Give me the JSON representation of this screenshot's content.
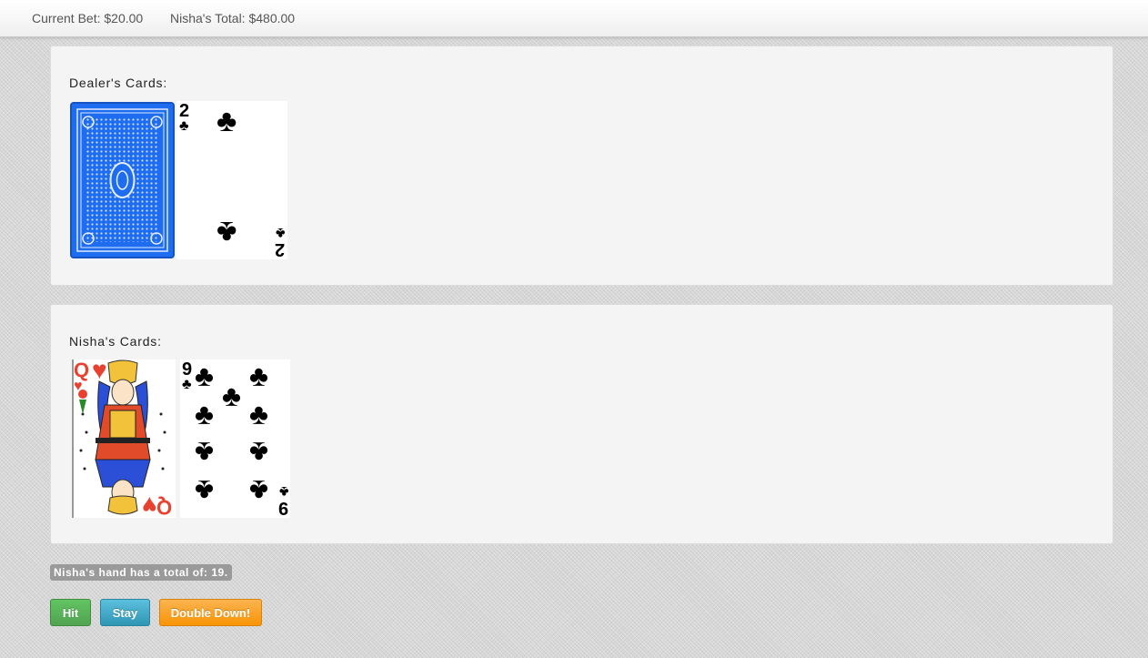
{
  "header": {
    "current_bet": "Current Bet: $20.00",
    "player_total": "Nisha's Total: $480.00"
  },
  "dealer": {
    "label": "Dealer's Cards:",
    "cards": [
      {
        "face": "back"
      },
      {
        "rank": "2",
        "suit": "clubs",
        "suit_symbol": "♣"
      }
    ]
  },
  "player": {
    "label": "Nisha's Cards:",
    "cards": [
      {
        "rank": "Q",
        "suit": "hearts",
        "suit_symbol": "♥"
      },
      {
        "rank": "9",
        "suit": "clubs",
        "suit_symbol": "♣"
      }
    ]
  },
  "hand_total_text": "Nisha's hand has a total of: 19.",
  "actions": {
    "hit": "Hit",
    "stay": "Stay",
    "double_down": "Double Down!"
  },
  "colors": {
    "hit": "#5cb85c",
    "stay": "#31a0c9",
    "double_down": "#f89406",
    "card_back": "#1e6cf0",
    "hearts": "#e8412f",
    "clubs": "#000000"
  }
}
